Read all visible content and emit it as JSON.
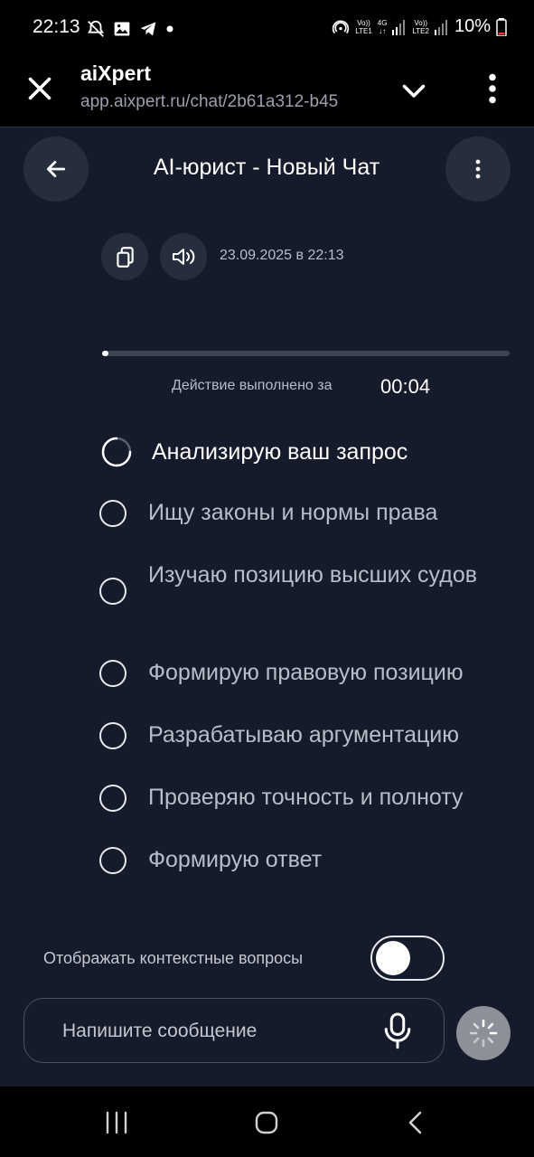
{
  "status_bar": {
    "time": "22:13",
    "battery": "10%",
    "sim1_top": "Vo))",
    "sim1_bottom": "LTE1",
    "net_top": "4G",
    "net_bottom": "↓↑",
    "sim2_top": "Vo))",
    "sim2_bottom": "LTE2"
  },
  "browser": {
    "title": "aiXpert",
    "url": "app.aixpert.ru/chat/2b61a312-b45"
  },
  "header": {
    "title": "AI-юрист - Новый Чат"
  },
  "message": {
    "timestamp": "23.09.2025 в 22:13"
  },
  "progress": {
    "value": 0.01,
    "label": "Действие выполнено за",
    "elapsed": "00:04"
  },
  "steps": [
    {
      "label": "Анализирую ваш запрос",
      "state": "in-progress"
    },
    {
      "label": "Ищу законы и нормы права",
      "state": "pending"
    },
    {
      "label": "Изучаю позицию высших судов",
      "state": "pending"
    },
    {
      "label": "Формирую правовую позицию",
      "state": "pending"
    },
    {
      "label": "Разрабатываю аргументацию",
      "state": "pending"
    },
    {
      "label": "Проверяю точность и полноту",
      "state": "pending"
    },
    {
      "label": "Формирую ответ",
      "state": "pending"
    }
  ],
  "context_toggle": {
    "label": "Отображать контекстные вопросы",
    "enabled": false
  },
  "composer": {
    "placeholder": "Напишите сообщение"
  },
  "colors": {
    "background": "#161b2b",
    "button_bg": "#262d3d",
    "send_button": "#8d9099"
  }
}
